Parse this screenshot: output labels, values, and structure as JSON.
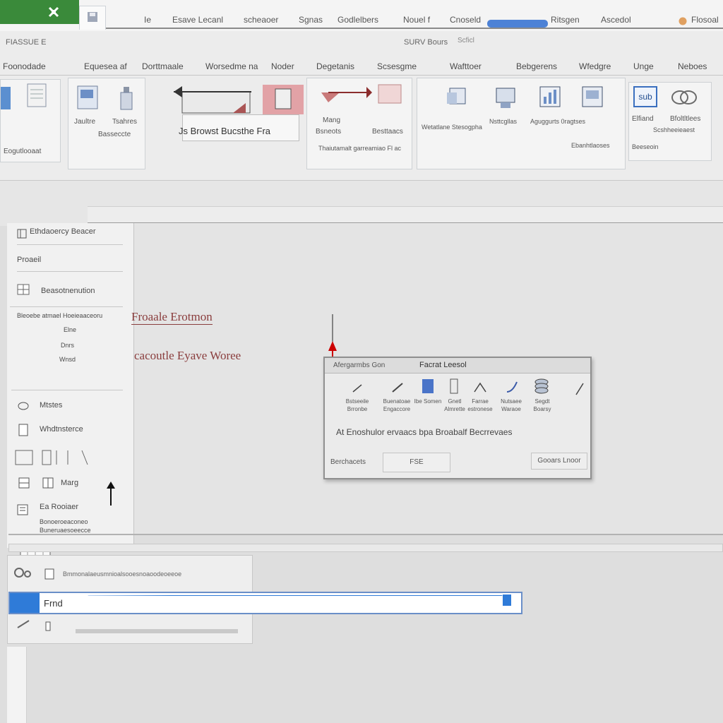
{
  "titlebar": {
    "menus": [
      "Ie",
      "Esave Lecanl",
      "scheaoer",
      "Sgnas",
      "Godlelbers",
      "Nouel f",
      "Cnoseld",
      "Ritsgen",
      "Ascedol",
      "Flosoal"
    ],
    "colors": {
      "app_accent": "#3a8a3a",
      "highlight": "#4d82d6"
    }
  },
  "ribbon": {
    "tag": "FIASSUE E",
    "title": "SURV Bours",
    "sub_title": "Scficl",
    "tabs": [
      "Foonodade",
      "Equesea af",
      "Dorttmaale",
      "Worsedme na",
      "Noder",
      "Degetanis",
      "Scsesgme",
      "Wafttoer",
      "Bebgerens",
      "Wfedgre",
      "Unge",
      "Neboes"
    ],
    "left_group_label": "Eogutlooaat",
    "group1": {
      "btn1": "Jaultre",
      "btn2": "Tsahres",
      "btn2b": "Basseccte"
    },
    "paste_caption": "Js Browst Bucsthe Fra",
    "group3": {
      "btn1": "Mang",
      "btn1b": "Bsneots",
      "btn2": "Besttaacs",
      "caption": "Thaiutamalt garreamiao Fl ac"
    },
    "group4": {
      "btn1": "Wetatlane Stesogpha",
      "btn2": "Nsttcgllas",
      "btn3": "Aguggurts 0ragtses",
      "btn3b": "Ebanhtlaoses"
    },
    "group5": {
      "sub_button": "sub",
      "btn1": "Elfiand",
      "btn2": "Bfoltltlees",
      "btn2b": "Scshheeieaest",
      "btn3": "Beeseoin"
    }
  },
  "nav_panel": {
    "items": [
      "Ethdaoercy Beacer",
      "Proaeil",
      "Beasotnenution",
      "Bleoebe atmael Hoeieaaceoru",
      "Mtstes",
      "Whdtnsterce",
      "Marg",
      "Ea Rooiaer",
      "Bonoeroeaconeo",
      "Buneruaesoeecce"
    ],
    "thumb_labels": [
      "Elne",
      "Dnrs",
      "Wnsd"
    ]
  },
  "document": {
    "line1": "Froaale Erotmon",
    "line2": "cacoutle Eyave Woree"
  },
  "dialog": {
    "title_left": "Afergarmbs Gon",
    "title": "Facrat Leesol",
    "buttons": [
      {
        "label": "Bstseeile Brronbe"
      },
      {
        "label": "Buenatoae Engaccore"
      },
      {
        "label": "Ibe Somen"
      },
      {
        "label": "Gnetl Almrette"
      },
      {
        "label": "Farrae estronese"
      },
      {
        "label": "Nutsaee Waraoe"
      },
      {
        "label": "Segdt Boarsy"
      }
    ],
    "description": "At Enoshulor ervaacs bpa Broabalf Becrrevaes",
    "field_label": "Berchacets",
    "field_value": "FSE",
    "action_button": "Gooars Lnoor"
  },
  "lower_panel": {
    "row1": "Bmmonalaeusmnioalsooesnoaoodeoeeoe",
    "find_value": "Frnd"
  }
}
